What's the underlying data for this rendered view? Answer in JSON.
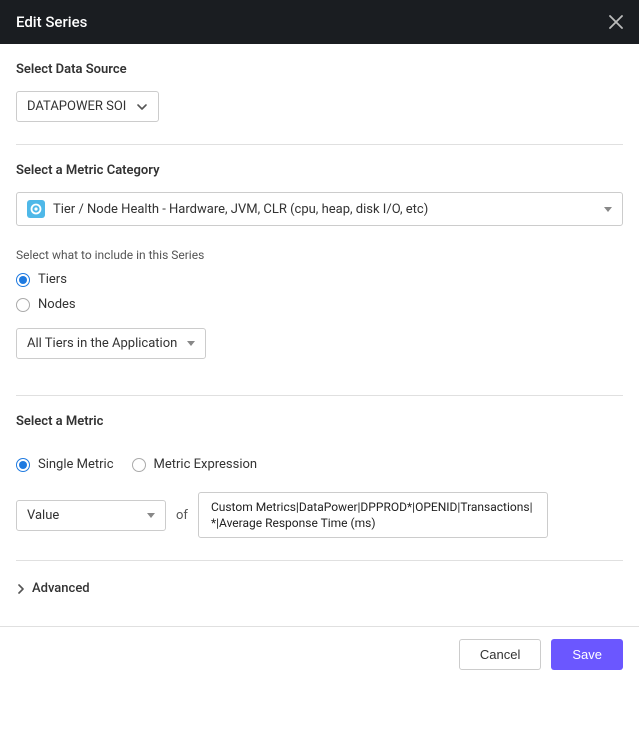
{
  "header": {
    "title": "Edit Series"
  },
  "dataSource": {
    "label": "Select Data Source",
    "value": "DATAPOWER SOI"
  },
  "metricCategory": {
    "label": "Select a Metric Category",
    "value": "Tier / Node Health - Hardware, JVM, CLR (cpu, heap, disk I/O, etc)"
  },
  "seriesInclude": {
    "label": "Select what to include in this Series",
    "options": [
      "Tiers",
      "Nodes"
    ],
    "selected": "Tiers",
    "scopeValue": "All Tiers in the Application"
  },
  "metric": {
    "label": "Select a Metric",
    "typeOptions": [
      "Single Metric",
      "Metric Expression"
    ],
    "selectedType": "Single Metric",
    "aggregation": "Value",
    "ofLabel": "of",
    "path": "Custom Metrics|DataPower|DPPROD*|OPENID|Transactions|*|Average Response Time (ms)"
  },
  "advanced": {
    "label": "Advanced"
  },
  "footer": {
    "cancel": "Cancel",
    "save": "Save"
  }
}
